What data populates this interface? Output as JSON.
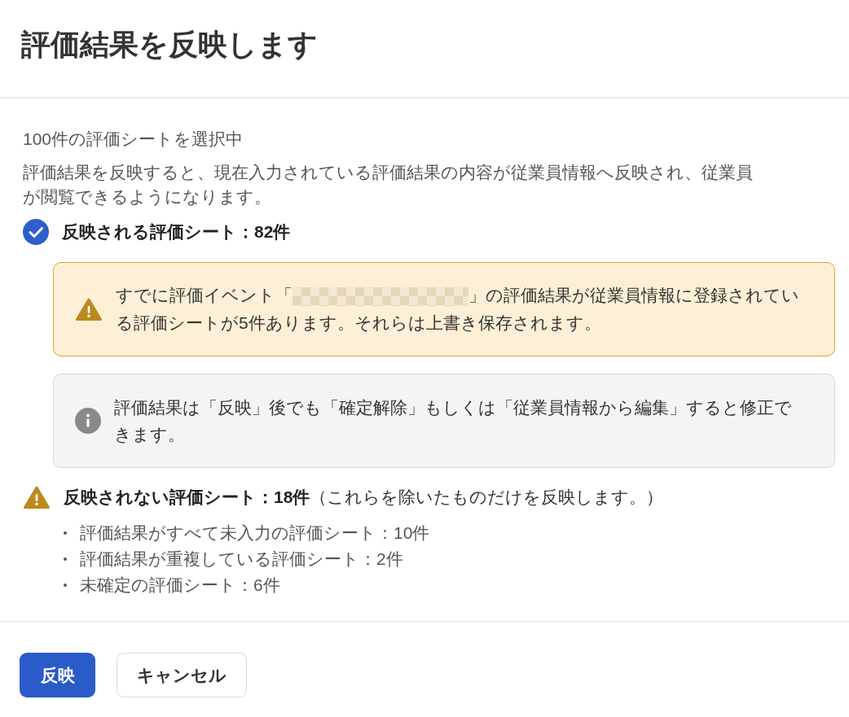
{
  "dialog": {
    "title": "評価結果を反映します"
  },
  "intro": [
    "100件の評価シートを選択中",
    "評価結果を反映すると、現在入力されている評価結果の内容が従業員情報へ反映され、従業員が閲覧できるようになります。"
  ],
  "groups": [
    {
      "kind": "success",
      "heading": "反映される評価シート：82件",
      "notices": [
        {
          "kind": "warning",
          "parts": [
            {
              "kind": "text",
              "text": "すでに評価イベント「"
            },
            {
              "kind": "redacted"
            },
            {
              "kind": "text",
              "text": "」の評価結果が従業員情報に登録されている評価シートが5件あります。それらは上書き保存されます。"
            }
          ]
        },
        {
          "kind": "info",
          "parts": [
            {
              "kind": "text",
              "text": "評価結果は「反映」後でも「確定解除」もしくは「従業員情報から編集」すると修正できます。"
            }
          ]
        }
      ]
    },
    {
      "kind": "warning",
      "heading": "反映されない評価シート：18件",
      "note": "（これらを除いたものだけを反映します。）",
      "items": [
        "評価結果がすべて未入力の評価シート：10件",
        "評価結果が重複している評価シート：2件",
        "未確定の評価シート：6件"
      ]
    }
  ],
  "buttons": [
    {
      "kind": "primary",
      "label": "反映"
    },
    {
      "kind": "secondary",
      "label": "キャンセル"
    }
  ]
}
